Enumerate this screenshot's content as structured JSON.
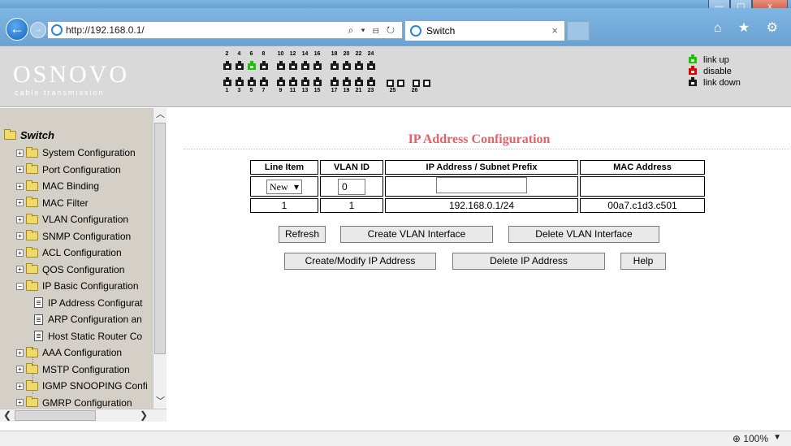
{
  "browser": {
    "url": "http://192.168.0.1/",
    "address_tools": "⌕ ▾ ⊟ ↻",
    "tab_title": "Switch",
    "tab_close": "×",
    "back": "←",
    "forward": "→",
    "right_icons": "⌂ ★ ⚙",
    "window_buttons": [
      "—",
      "▢",
      "x"
    ],
    "zoom": "100%",
    "zoom_icon": "⊕"
  },
  "banner": {
    "logo": "OSNOVO",
    "logo_sub": "cable transmission",
    "top_port_numbers": [
      "2",
      "4",
      "6",
      "8",
      "10",
      "12",
      "14",
      "16",
      "18",
      "20",
      "22",
      "24"
    ],
    "bottom_port_numbers": [
      "1",
      "3",
      "5",
      "7",
      "9",
      "11",
      "13",
      "15",
      "17",
      "19",
      "21",
      "23",
      "25",
      "26"
    ],
    "top_port_states": [
      "down",
      "down",
      "up",
      "down",
      "down",
      "down",
      "down",
      "down",
      "down",
      "down",
      "down",
      "down"
    ],
    "bottom_port_states": [
      "down",
      "down",
      "down",
      "down",
      "down",
      "down",
      "down",
      "down",
      "down",
      "down",
      "down",
      "down"
    ],
    "legend": [
      {
        "label": "link up",
        "state": "up"
      },
      {
        "label": "disable",
        "state": "disabled"
      },
      {
        "label": "link down",
        "state": "down"
      }
    ],
    "colors": {
      "link_up": "#19c400",
      "disable": "#e00000",
      "link_down": "#1c1c1c"
    }
  },
  "sidebar": {
    "root": "Switch",
    "items": [
      {
        "label": "System Configuration",
        "type": "folder"
      },
      {
        "label": "Port Configuration",
        "type": "folder"
      },
      {
        "label": "MAC Binding",
        "type": "folder"
      },
      {
        "label": "MAC Filter",
        "type": "folder"
      },
      {
        "label": "VLAN Configuration",
        "type": "folder"
      },
      {
        "label": "SNMP Configuration",
        "type": "folder"
      },
      {
        "label": "ACL Configuration",
        "type": "folder"
      },
      {
        "label": "QOS Configuration",
        "type": "folder"
      },
      {
        "label": "IP Basic Configuration",
        "type": "folder-open"
      },
      {
        "label": "IP Address Configurat",
        "type": "doc"
      },
      {
        "label": "ARP Configuration an",
        "type": "doc"
      },
      {
        "label": "Host Static Router Co",
        "type": "doc"
      },
      {
        "label": "AAA Configuration",
        "type": "folder"
      },
      {
        "label": "MSTP Configuration",
        "type": "folder"
      },
      {
        "label": "IGMP SNOOPING Confi",
        "type": "folder"
      },
      {
        "label": "GMRP Configuration",
        "type": "folder"
      }
    ]
  },
  "main": {
    "title": "IP Address Configuration",
    "table": {
      "headers": [
        "Line Item",
        "VLAN ID",
        "IP Address / Subnet Prefix",
        "MAC Address"
      ],
      "new_row": {
        "line_item": "New",
        "vlan_id": "0",
        "ip": "",
        "mac": ""
      },
      "rows": [
        {
          "line_item": "1",
          "vlan_id": "1",
          "ip": "192.168.0.1/24",
          "mac": "00a7.c1d3.c501"
        }
      ]
    },
    "buttons": {
      "refresh": "Refresh",
      "create_vlan_interface": "Create VLAN Interface",
      "delete_vlan_interface": "Delete VLAN Interface",
      "create_modify_ip": "Create/Modify IP Address",
      "delete_ip": "Delete IP Address",
      "help": "Help"
    }
  }
}
